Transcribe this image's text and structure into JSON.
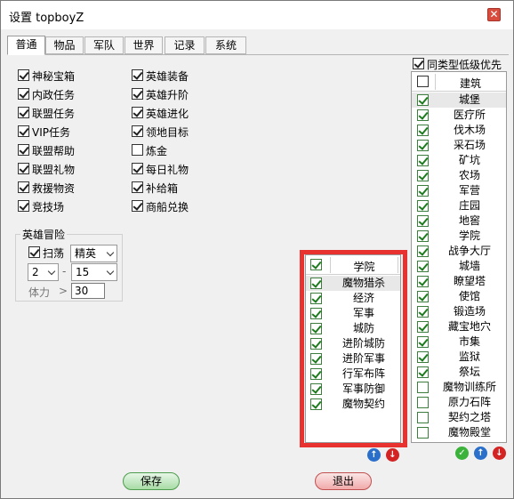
{
  "window": {
    "title": "设置 topboyZ",
    "close_glyph": "✕"
  },
  "tabs": [
    "普通",
    "物品",
    "军队",
    "世界",
    "记录",
    "系统"
  ],
  "left_col": [
    {
      "label": "神秘宝箱",
      "checked": true
    },
    {
      "label": "内政任务",
      "checked": true
    },
    {
      "label": "联盟任务",
      "checked": true
    },
    {
      "label": "VIP任务",
      "checked": true
    },
    {
      "label": "联盟帮助",
      "checked": true
    },
    {
      "label": "联盟礼物",
      "checked": true
    },
    {
      "label": "救援物资",
      "checked": true
    },
    {
      "label": "竞技场",
      "checked": true
    }
  ],
  "right_col": [
    {
      "label": "英雄装备",
      "checked": true
    },
    {
      "label": "英雄升阶",
      "checked": true
    },
    {
      "label": "英雄进化",
      "checked": true
    },
    {
      "label": "领地目标",
      "checked": true
    },
    {
      "label": "炼金",
      "checked": false
    },
    {
      "label": "每日礼物",
      "checked": true
    },
    {
      "label": "补给箱",
      "checked": true
    },
    {
      "label": "商船兑换",
      "checked": true
    }
  ],
  "hero": {
    "title": "英雄冒险",
    "sweep_label": "扫荡",
    "sweep_checked": true,
    "mode": "精英",
    "chapter": "2",
    "dash": "-",
    "stage": "15",
    "stamina_label": "体力",
    "gt": ">",
    "stamina_value": "30"
  },
  "academy_list": {
    "header": "学院",
    "header_checked": true,
    "items": [
      {
        "label": "魔物猎杀",
        "checked": true,
        "selected": true
      },
      {
        "label": "经济",
        "checked": true
      },
      {
        "label": "军事",
        "checked": true
      },
      {
        "label": "城防",
        "checked": true
      },
      {
        "label": "进阶城防",
        "checked": true
      },
      {
        "label": "进阶军事",
        "checked": true
      },
      {
        "label": "行军布阵",
        "checked": true
      },
      {
        "label": "军事防御",
        "checked": true
      },
      {
        "label": "魔物契约",
        "checked": true
      }
    ]
  },
  "build_list": {
    "prefer_label": "同类型低级优先",
    "prefer_checked": true,
    "header": "建筑",
    "header_checked": false,
    "items": [
      {
        "label": "城堡",
        "checked": true,
        "selected": true
      },
      {
        "label": "医疗所",
        "checked": true
      },
      {
        "label": "伐木场",
        "checked": true
      },
      {
        "label": "采石场",
        "checked": true
      },
      {
        "label": "矿坑",
        "checked": true
      },
      {
        "label": "农场",
        "checked": true
      },
      {
        "label": "军营",
        "checked": true
      },
      {
        "label": "庄园",
        "checked": true
      },
      {
        "label": "地窖",
        "checked": true
      },
      {
        "label": "学院",
        "checked": true
      },
      {
        "label": "战争大厅",
        "checked": true
      },
      {
        "label": "城墙",
        "checked": true
      },
      {
        "label": "瞭望塔",
        "checked": true
      },
      {
        "label": "使馆",
        "checked": true
      },
      {
        "label": "锻造场",
        "checked": true
      },
      {
        "label": "藏宝地穴",
        "checked": true
      },
      {
        "label": "市集",
        "checked": true
      },
      {
        "label": "监狱",
        "checked": true
      },
      {
        "label": "祭坛",
        "checked": true
      },
      {
        "label": "魔物训练所",
        "checked": false
      },
      {
        "label": "原力石阵",
        "checked": false
      },
      {
        "label": "契约之塔",
        "checked": false
      },
      {
        "label": "魔物殿堂",
        "checked": false
      }
    ]
  },
  "arrows": {
    "up": "↑",
    "down": "↓",
    "ok": "✓"
  },
  "buttons": {
    "save": "保存",
    "exit": "退出"
  },
  "colors": {
    "highlight_box": "#e8322f",
    "check_green": "#1e7a1e"
  }
}
